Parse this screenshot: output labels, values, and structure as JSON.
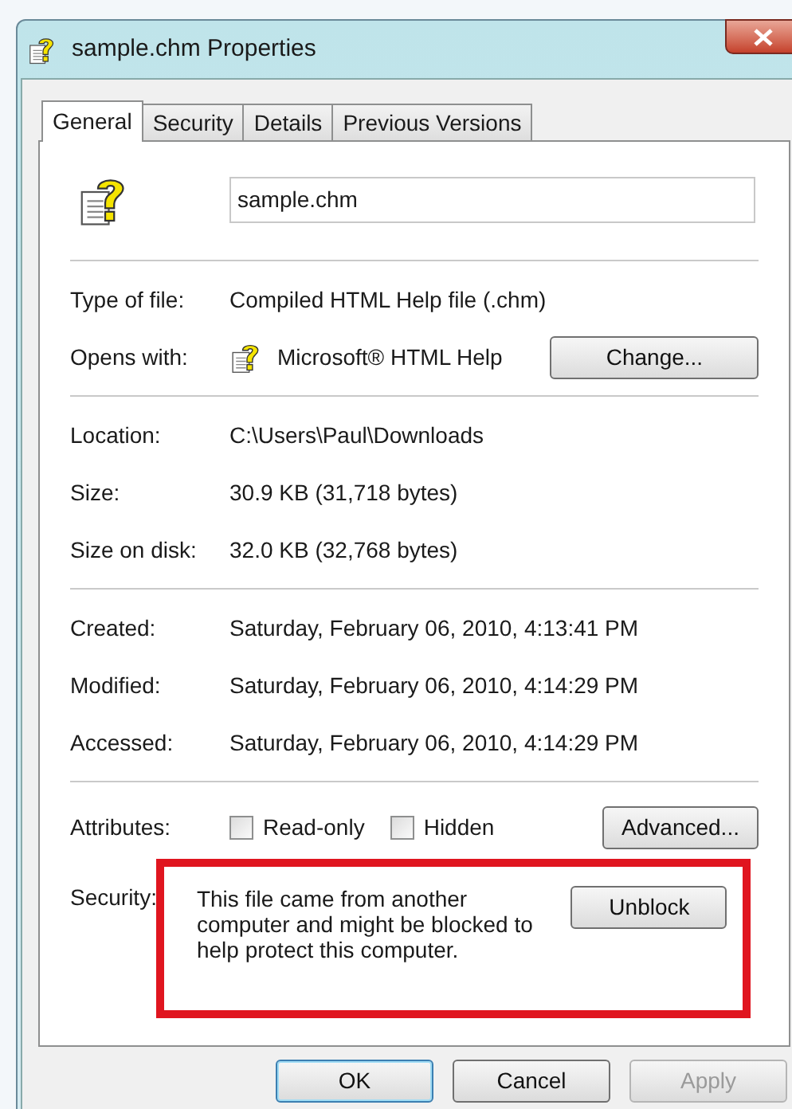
{
  "window": {
    "title": "sample.chm Properties"
  },
  "tabs": [
    {
      "label": "General",
      "selected": true
    },
    {
      "label": "Security",
      "selected": false
    },
    {
      "label": "Details",
      "selected": false
    },
    {
      "label": "Previous Versions",
      "selected": false
    }
  ],
  "file_name": {
    "value": "sample.chm"
  },
  "sections": [
    {
      "rows": [
        {
          "kind": "text",
          "label": "Type of file:",
          "value": "Compiled HTML Help file (.chm)"
        },
        {
          "kind": "app",
          "label": "Opens with:",
          "value": "Microsoft® HTML Help",
          "button": "Change..."
        }
      ]
    },
    {
      "rows": [
        {
          "kind": "text",
          "label": "Location:",
          "value": "C:\\Users\\Paul\\Downloads"
        },
        {
          "kind": "text",
          "label": "Size:",
          "value": "30.9 KB (31,718 bytes)"
        },
        {
          "kind": "text",
          "label": "Size on disk:",
          "value": "32.0 KB (32,768 bytes)"
        }
      ]
    },
    {
      "rows": [
        {
          "kind": "text",
          "label": "Created:",
          "value": "Saturday, February 06, 2010, 4:13:41 PM"
        },
        {
          "kind": "text",
          "label": "Modified:",
          "value": "Saturday, February 06, 2010, 4:14:29 PM"
        },
        {
          "kind": "text",
          "label": "Accessed:",
          "value": "Saturday, February 06, 2010, 4:14:29 PM"
        }
      ]
    }
  ],
  "attributes": {
    "label": "Attributes:",
    "checkboxes": [
      {
        "label": "Read-only",
        "checked": false
      },
      {
        "label": "Hidden",
        "checked": false
      }
    ],
    "button": "Advanced..."
  },
  "security": {
    "label": "Security:",
    "message": "This file came from another computer and might be blocked to help protect this computer.",
    "button": "Unblock",
    "highlighted": true
  },
  "buttons": [
    {
      "label": "OK",
      "default": true,
      "disabled": false
    },
    {
      "label": "Cancel",
      "default": false,
      "disabled": false
    },
    {
      "label": "Apply",
      "default": false,
      "disabled": true
    }
  ]
}
